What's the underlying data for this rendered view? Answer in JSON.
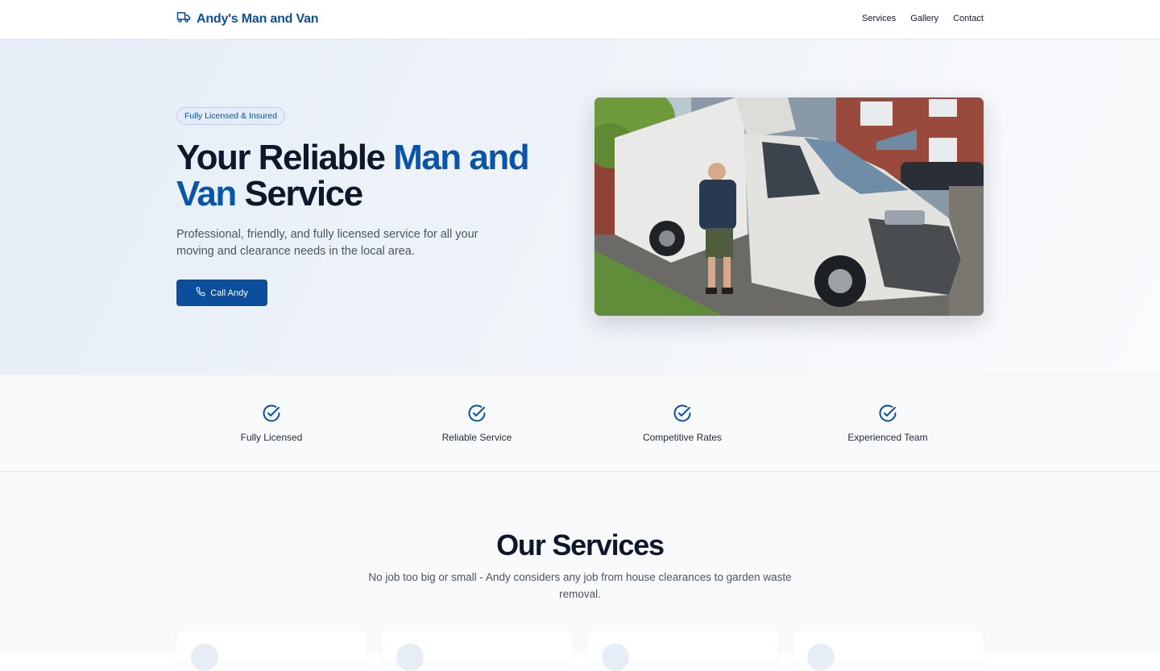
{
  "nav": {
    "brand": "Andy's Man and Van",
    "brand_icon": "truck-icon",
    "links": [
      "Services",
      "Gallery",
      "Contact"
    ]
  },
  "hero": {
    "badge": "Fully Licensed & Insured",
    "headline_part1": "Your Reliable ",
    "headline_accent": "Man and Van",
    "headline_part2": " Service",
    "subtitle": "Professional, friendly, and fully licensed service for all your moving and clearance needs in the local area.",
    "cta_label": "Call Andy",
    "cta_icon": "phone-icon"
  },
  "features": [
    {
      "label": "Fully Licensed",
      "icon": "check-circle-icon"
    },
    {
      "label": "Reliable Service",
      "icon": "check-circle-icon"
    },
    {
      "label": "Competitive Rates",
      "icon": "check-circle-icon"
    },
    {
      "label": "Experienced Team",
      "icon": "check-circle-icon"
    }
  ],
  "services": {
    "title": "Our Services",
    "subtitle": "No job too big or small - Andy considers any job from house clearances to garden waste removal."
  },
  "colors": {
    "brand": "#0b4f9c",
    "accent": "#0b55a8",
    "heading": "#0f172a",
    "body": "#4b5563"
  }
}
